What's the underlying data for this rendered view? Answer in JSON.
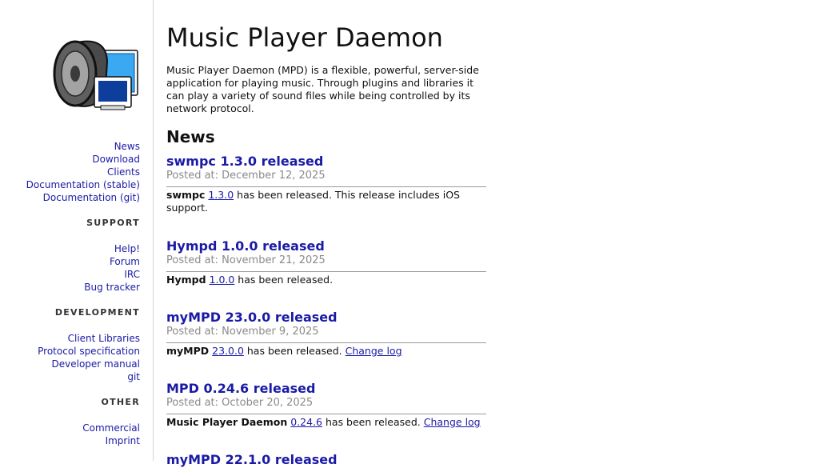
{
  "site": {
    "title": "Music Player Daemon",
    "intro": "Music Player Daemon (MPD) is a flexible, powerful, server-side application for playing music. Through plugins and libraries it can play a variety of sound files while being controlled by its network protocol."
  },
  "sidebar": {
    "main_links": [
      "News",
      "Download",
      "Clients",
      "Documentation (stable)",
      "Documentation (git)"
    ],
    "support": {
      "heading": "SUPPORT",
      "links": [
        "Help!",
        "Forum",
        "IRC",
        "Bug tracker"
      ]
    },
    "development": {
      "heading": "DEVELOPMENT",
      "links": [
        "Client Libraries",
        "Protocol specification",
        "Developer manual",
        "git"
      ]
    },
    "other": {
      "heading": "OTHER",
      "links": [
        "Commercial",
        "Imprint"
      ]
    }
  },
  "news": {
    "heading": "News",
    "posts": [
      {
        "title": "swmpc 1.3.0 released",
        "date": "Posted at: December 12, 2025",
        "name": "swmpc",
        "version": "1.3.0",
        "text": " has been released. This release includes iOS support.",
        "changelog": ""
      },
      {
        "title": "Hympd 1.0.0 released",
        "date": "Posted at: November 21, 2025",
        "name": "Hympd",
        "version": "1.0.0",
        "text": " has been released.",
        "changelog": ""
      },
      {
        "title": "myMPD 23.0.0 released",
        "date": "Posted at: November 9, 2025",
        "name": "myMPD",
        "version": "23.0.0",
        "text": " has been released. ",
        "changelog": "Change log"
      },
      {
        "title": "MPD 0.24.6 released",
        "date": "Posted at: October 20, 2025",
        "name": "Music Player Daemon",
        "version": "0.24.6",
        "text": " has been released. ",
        "changelog": "Change log"
      },
      {
        "title": "myMPD 22.1.0 released",
        "date": "",
        "name": "",
        "version": "",
        "text": "",
        "changelog": ""
      }
    ]
  },
  "icons": {
    "logo": "speaker-monitor-logo-icon"
  },
  "colors": {
    "link": "#1a1aa6",
    "date": "#8a8a8a",
    "sidebar_border": "#d6d6d6"
  }
}
